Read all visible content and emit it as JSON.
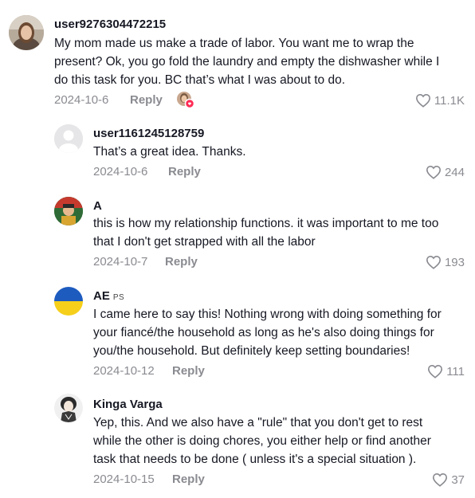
{
  "comments": [
    {
      "username": "user9276304472215",
      "text_lines": [
        "My mom made us make a trade of labor. You want me to wrap the",
        "present? Ok, you go fold the laundry and empty the dishwasher while I",
        "do this task for you. BC that’s what I was about to do."
      ],
      "date": "2024-10-6",
      "reply_label": "Reply",
      "likes": "11.1K"
    },
    {
      "username": "user1161245128759",
      "text_lines": [
        "That’s a great idea. Thanks."
      ],
      "date": "2024-10-6",
      "reply_label": "Reply",
      "likes": "244"
    },
    {
      "username": "A",
      "text_lines": [
        "this is how my relationship functions. it was important to me too",
        "that I don't get strapped with all the labor"
      ],
      "date": "2024-10-7",
      "reply_label": "Reply",
      "likes": "193"
    },
    {
      "username": "AE",
      "username_suffix": "PS",
      "text_lines": [
        "I came here to say this! Nothing wrong with doing something for",
        "your fiancé/the household as long as he's also doing things for",
        "you/the household. But definitely keep setting boundaries!"
      ],
      "date": "2024-10-12",
      "reply_label": "Reply",
      "likes": "111"
    },
    {
      "username": "Kinga Varga",
      "text_lines": [
        "Yep, this. And we also have a \"rule\" that you don't get to rest",
        "while the other is doing chores, you either help or find another",
        "task that needs to be done ( unless it's a special situation )."
      ],
      "date": "2024-10-15",
      "reply_label": "Reply",
      "likes": "37"
    }
  ],
  "colors": {
    "text": "#161823",
    "muted": "#8a8b91",
    "flag_blue": "#1d5bbf",
    "flag_yellow": "#f5cf1a",
    "creator_badge": "#fe2c55"
  }
}
